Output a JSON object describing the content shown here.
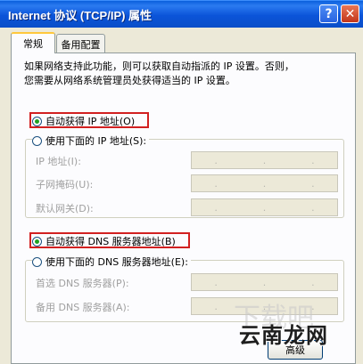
{
  "window": {
    "title": "Internet 协议 (TCP/IP) 属性",
    "help_label": "?",
    "close_label": "✕"
  },
  "tabs": [
    {
      "label": "常规",
      "active": true
    },
    {
      "label": "备用配置",
      "active": false
    }
  ],
  "description": "如果网络支持此功能，则可以获取自动指派的 IP 设置。否则，\n您需要从网络系统管理员处获得适当的 IP 设置。",
  "ip_section": {
    "auto_label": "自动获得 IP 地址(O)",
    "auto_checked": true,
    "manual_label": "使用下面的 IP 地址(S):",
    "manual_checked": false,
    "fields": [
      {
        "label": "IP 地址(I):"
      },
      {
        "label": "子网掩码(U):"
      },
      {
        "label": "默认网关(D):"
      }
    ]
  },
  "dns_section": {
    "auto_label": "自动获得 DNS 服务器地址(B)",
    "auto_checked": true,
    "manual_label": "使用下面的 DNS 服务器地址(E):",
    "manual_checked": false,
    "fields": [
      {
        "label": "首选 DNS 服务器(P):"
      },
      {
        "label": "备用 DNS 服务器(A):"
      }
    ]
  },
  "footer": {
    "button_partial": "高级"
  },
  "watermark": {
    "text": "云南龙网",
    "background_text": "下载吧"
  },
  "colors": {
    "titlebar": "#0b54d9",
    "highlight_box": "#d22020",
    "radio_dot": "#21a121",
    "dialog_bg": "#ece9d8"
  }
}
